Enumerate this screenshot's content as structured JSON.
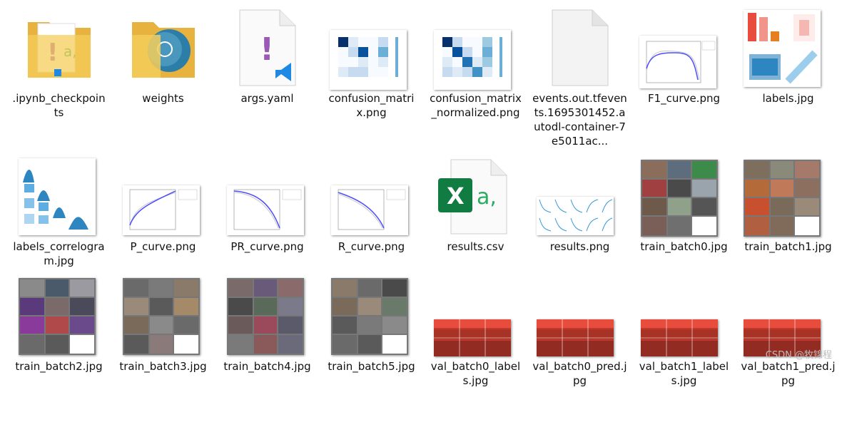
{
  "files": [
    {
      "name": ".ipynb_checkpoints",
      "type": "folder",
      "icon": "folder-icon"
    },
    {
      "name": "weights",
      "type": "folder",
      "icon": "folder-icon"
    },
    {
      "name": "args.yaml",
      "type": "yaml",
      "icon": "yaml-file-icon"
    },
    {
      "name": "confusion_matrix.png",
      "type": "image"
    },
    {
      "name": "confusion_matrix_normalized.png",
      "type": "image"
    },
    {
      "name": "events.out.tfevents.1695301452.autodl-container-7e5011ac...",
      "type": "file",
      "icon": "blank-file-icon"
    },
    {
      "name": "F1_curve.png",
      "type": "image"
    },
    {
      "name": "labels.jpg",
      "type": "image"
    },
    {
      "name": "labels_correlogram.jpg",
      "type": "image"
    },
    {
      "name": "P_curve.png",
      "type": "image"
    },
    {
      "name": "PR_curve.png",
      "type": "image"
    },
    {
      "name": "R_curve.png",
      "type": "image"
    },
    {
      "name": "results.csv",
      "type": "csv",
      "icon": "excel-file-icon"
    },
    {
      "name": "results.png",
      "type": "image"
    },
    {
      "name": "train_batch0.jpg",
      "type": "image"
    },
    {
      "name": "train_batch1.jpg",
      "type": "image"
    },
    {
      "name": "train_batch2.jpg",
      "type": "image"
    },
    {
      "name": "train_batch3.jpg",
      "type": "image"
    },
    {
      "name": "train_batch4.jpg",
      "type": "image"
    },
    {
      "name": "train_batch5.jpg",
      "type": "image"
    },
    {
      "name": "val_batch0_labels.jpg",
      "type": "image"
    },
    {
      "name": "val_batch0_pred.jpg",
      "type": "image"
    },
    {
      "name": "val_batch1_labels.jpg",
      "type": "image"
    },
    {
      "name": "val_batch1_pred.jpg",
      "type": "image"
    }
  ],
  "icon_glyphs": {
    "yaml_mark": "!",
    "excel_letter": "X",
    "excel_suffix": "a,"
  },
  "colors": {
    "folder": "#f2c24b",
    "excel": "#107c41",
    "vscode": "#1e88e5",
    "yaml_mark": "#9b59b6",
    "cm_dark": "#08306b",
    "curve": "#4d4dff"
  },
  "watermark": "CSDN @牧锦程"
}
